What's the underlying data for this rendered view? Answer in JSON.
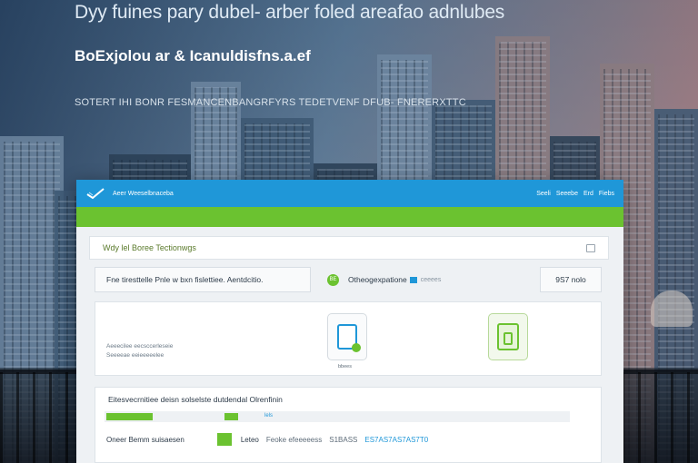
{
  "hero": {
    "headline": "Dyy fuines pary dubel- arber foled areafao adnlubes",
    "subhead": "BoExjolou ar & Icanuldisfns.a.ef",
    "tagline": "SOTERT IHI BONR FESMANCENBANGRFYRS TEDETVENF DFUB- FNERERXTTC"
  },
  "window": {
    "app_title": "Aeer Weeselbnaceba",
    "nav": [
      "Seeli",
      "Seeebe",
      "Erd",
      "Fiebs"
    ],
    "section_title": "Wdy lel Boree Tectionwgs",
    "row1": {
      "label": "Fne tiresttelle Pnle w bxn fislettiee. Aentdcitio.",
      "badge": "BE",
      "item": "Otheogexpatione",
      "item_extra": "ceeees",
      "count": "9S7 nolo"
    },
    "panel": {
      "caption_line1": "Aeeecilee eecsccerleseie",
      "caption_line2": "Seeeeae eeieeeeelee",
      "card_left_label": "bbees",
      "progress_a_pct": 10,
      "progress_b_pct": 3
    },
    "list": {
      "title": "Eitesvecrnitiee deisn solselste dutdendal Olrenfinin",
      "progress_text": "lels",
      "row2_name": "Oneer Bemm suisaesen",
      "row2_field": "Leteo",
      "row2_desc": "Feoke efeeeeess",
      "row2_code": "S1BASS",
      "row2_amount": "ES7AS7AS7AS7T0"
    }
  }
}
